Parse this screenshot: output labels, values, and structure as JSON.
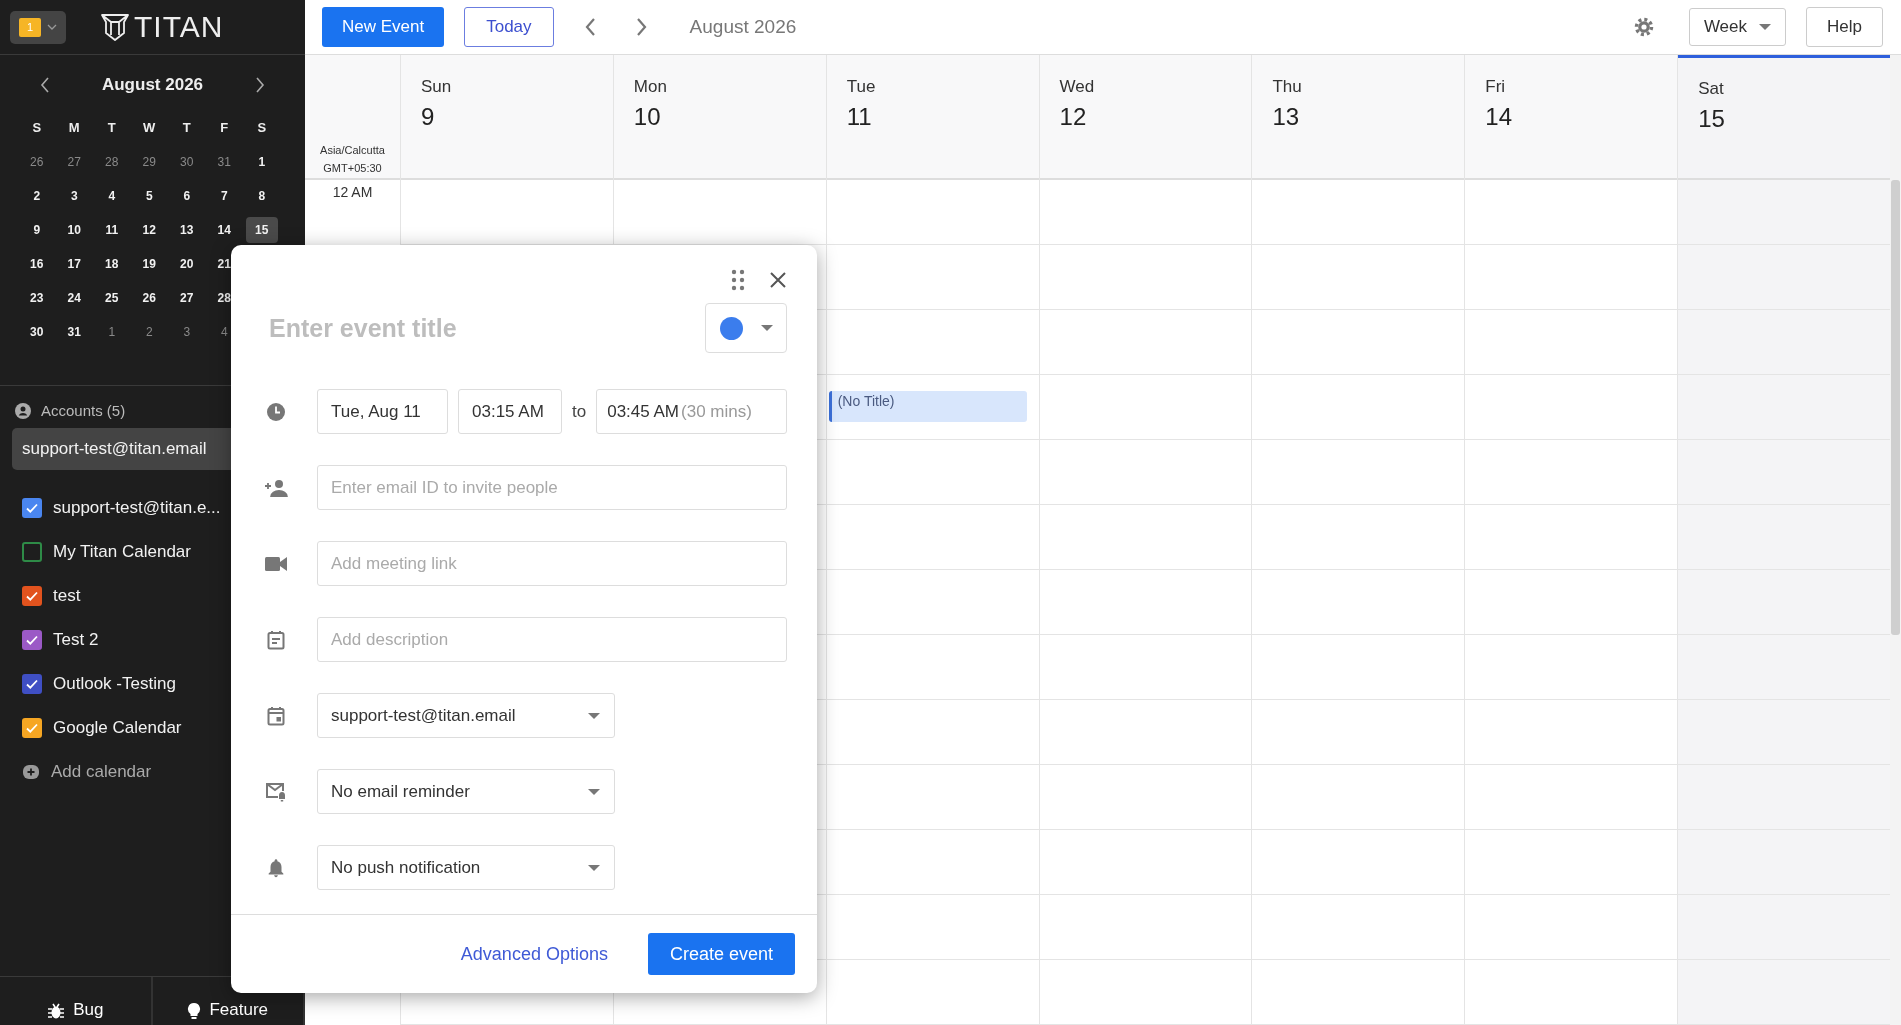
{
  "app_header": {
    "badge": "1",
    "logo": "TITAN"
  },
  "mini_calendar": {
    "title": "August 2026",
    "weekdays": [
      "S",
      "M",
      "T",
      "W",
      "T",
      "F",
      "S"
    ],
    "weeks": [
      [
        {
          "day": "26",
          "muted": true,
          "selected": false
        },
        {
          "day": "27",
          "muted": true,
          "selected": false
        },
        {
          "day": "28",
          "muted": true,
          "selected": false
        },
        {
          "day": "29",
          "muted": true,
          "selected": false
        },
        {
          "day": "30",
          "muted": true,
          "selected": false
        },
        {
          "day": "31",
          "muted": true,
          "selected": false
        },
        {
          "day": "1",
          "muted": false,
          "selected": false
        }
      ],
      [
        {
          "day": "2",
          "muted": false,
          "selected": false
        },
        {
          "day": "3",
          "muted": false,
          "selected": false
        },
        {
          "day": "4",
          "muted": false,
          "selected": false
        },
        {
          "day": "5",
          "muted": false,
          "selected": false
        },
        {
          "day": "6",
          "muted": false,
          "selected": false
        },
        {
          "day": "7",
          "muted": false,
          "selected": false
        },
        {
          "day": "8",
          "muted": false,
          "selected": false
        }
      ],
      [
        {
          "day": "9",
          "muted": false,
          "selected": false
        },
        {
          "day": "10",
          "muted": false,
          "selected": false
        },
        {
          "day": "11",
          "muted": false,
          "selected": false
        },
        {
          "day": "12",
          "muted": false,
          "selected": false
        },
        {
          "day": "13",
          "muted": false,
          "selected": false
        },
        {
          "day": "14",
          "muted": false,
          "selected": false
        },
        {
          "day": "15",
          "muted": false,
          "selected": true
        }
      ],
      [
        {
          "day": "16",
          "muted": false,
          "selected": false
        },
        {
          "day": "17",
          "muted": false,
          "selected": false
        },
        {
          "day": "18",
          "muted": false,
          "selected": false
        },
        {
          "day": "19",
          "muted": false,
          "selected": false
        },
        {
          "day": "20",
          "muted": false,
          "selected": false
        },
        {
          "day": "21",
          "muted": false,
          "selected": false
        }
      ],
      [
        {
          "day": "23",
          "muted": false,
          "selected": false
        },
        {
          "day": "24",
          "muted": false,
          "selected": false
        },
        {
          "day": "25",
          "muted": false,
          "selected": false
        },
        {
          "day": "26",
          "muted": false,
          "selected": false
        },
        {
          "day": "27",
          "muted": false,
          "selected": false
        },
        {
          "day": "28",
          "muted": false,
          "selected": false
        }
      ],
      [
        {
          "day": "30",
          "muted": false,
          "selected": false
        },
        {
          "day": "31",
          "muted": false,
          "selected": false
        },
        {
          "day": "1",
          "muted": true,
          "selected": false
        },
        {
          "day": "2",
          "muted": true,
          "selected": false
        },
        {
          "day": "3",
          "muted": true,
          "selected": false
        },
        {
          "day": "4",
          "muted": true,
          "selected": false
        }
      ]
    ]
  },
  "accounts": {
    "label": "Accounts (5)",
    "current": "support-test@titan.email"
  },
  "calendars": [
    {
      "name": "support-test@titan.e...",
      "checked": true,
      "color": "#4a86f0"
    },
    {
      "name": "My Titan Calendar",
      "checked": false,
      "color": "#2e8b47"
    },
    {
      "name": "test",
      "checked": true,
      "color": "#e2531e"
    },
    {
      "name": "Test 2",
      "checked": true,
      "color": "#9b59c6"
    },
    {
      "name": "Outlook -Testing",
      "checked": true,
      "color": "#3f4fc4"
    },
    {
      "name": "Google Calendar",
      "checked": true,
      "color": "#f6a623"
    }
  ],
  "add_calendar": "Add calendar",
  "footer_buttons": [
    {
      "kind": "bug",
      "label": "Bug"
    },
    {
      "kind": "idea",
      "label": "Feature"
    }
  ],
  "toolbar": {
    "new_event": "New Event",
    "today": "Today",
    "title": "August 2026",
    "view": "Week",
    "help": "Help"
  },
  "timezone": {
    "zone": "Asia/Calcutta",
    "offset": "GMT+05:30"
  },
  "hours": [
    "12 AM"
  ],
  "days": [
    {
      "weekday": "Sun",
      "date": "9",
      "today": false
    },
    {
      "weekday": "Mon",
      "date": "10",
      "today": false
    },
    {
      "weekday": "Tue",
      "date": "11",
      "today": false,
      "events": [
        {
          "title": "(No Title)"
        }
      ]
    },
    {
      "weekday": "Wed",
      "date": "12",
      "today": false
    },
    {
      "weekday": "Thu",
      "date": "13",
      "today": false
    },
    {
      "weekday": "Fri",
      "date": "14",
      "today": false
    },
    {
      "weekday": "Sat",
      "date": "15",
      "today": true
    }
  ],
  "dialog": {
    "title_placeholder": "Enter event title",
    "color": "#3b7ded",
    "date": "Tue, Aug 11",
    "start": "03:15 AM",
    "to": "to",
    "end": "03:45 AM",
    "duration": "(30 mins)",
    "invite_placeholder": "Enter email ID to invite people",
    "link_placeholder": "Add meeting link",
    "description_placeholder": "Add description",
    "calendar": "support-test@titan.email",
    "email_reminder": "No email reminder",
    "push_notification": "No push notification",
    "advanced": "Advanced Options",
    "create": "Create event"
  }
}
